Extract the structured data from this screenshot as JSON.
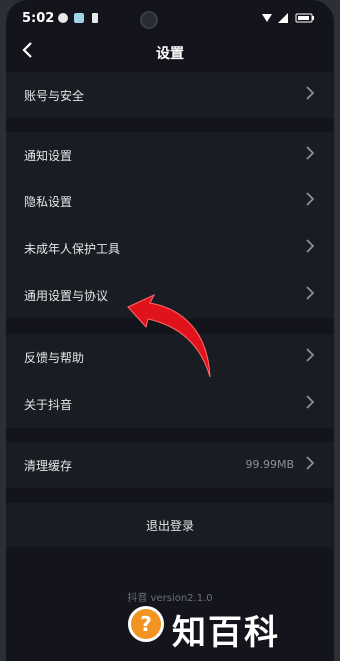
{
  "status_bar": {
    "time": "5:02"
  },
  "header": {
    "title": "设置",
    "back_icon": "chevron-left-icon"
  },
  "groups": [
    {
      "items": [
        {
          "label": "账号与安全"
        }
      ]
    },
    {
      "items": [
        {
          "label": "通知设置"
        },
        {
          "label": "隐私设置"
        },
        {
          "label": "未成年人保护工具"
        },
        {
          "label": "通用设置与协议"
        }
      ]
    },
    {
      "items": [
        {
          "label": "反馈与帮助"
        },
        {
          "label": "关于抖音"
        }
      ]
    },
    {
      "items": [
        {
          "label": "清理缓存",
          "value": "99.99MB"
        }
      ]
    }
  ],
  "logout": {
    "label": "退出登录"
  },
  "footer": {
    "version": "抖音 version2.1.0"
  },
  "watermark": {
    "text": "知百科",
    "icon_glyph": "?"
  },
  "colors": {
    "background": "#14151c",
    "group_background": "#1a1c24",
    "arrow": "#e0121b"
  }
}
